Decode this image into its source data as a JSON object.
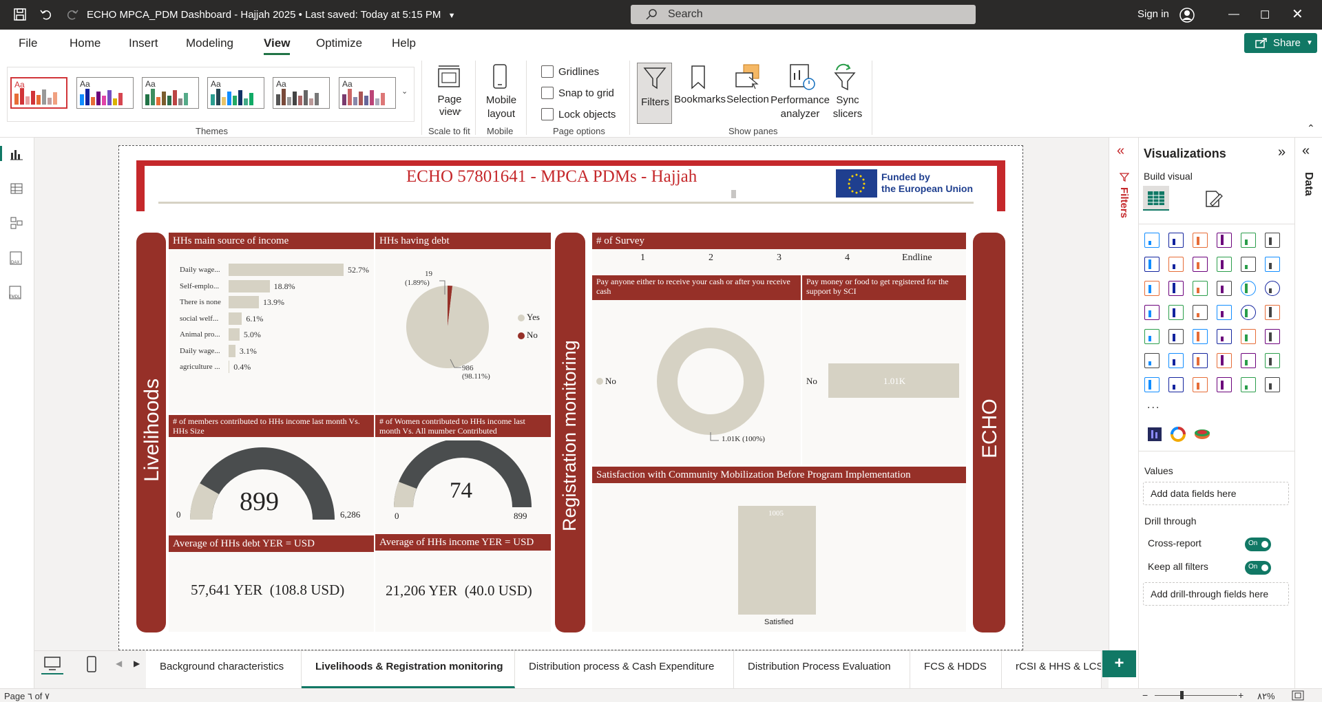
{
  "titlebar": {
    "file_title": "ECHO MPCA_PDM Dashboard - Hajjah 2025",
    "saved": "Last saved: Today at 5:15 PM",
    "search_placeholder": "Search",
    "signin": "Sign in"
  },
  "menu": {
    "items": [
      "File",
      "Home",
      "Insert",
      "Modeling",
      "View",
      "Optimize",
      "Help"
    ],
    "active": "View",
    "share": "Share"
  },
  "ribbon": {
    "themes_label": "Themes",
    "page_view": "Page view",
    "scale_to_fit": "Scale to fit",
    "mobile_layout": "Mobile layout",
    "mobile": "Mobile",
    "gridlines": "Gridlines",
    "snap_to_grid": "Snap to grid",
    "lock_objects": "Lock objects",
    "page_options": "Page options",
    "filters": "Filters",
    "bookmarks": "Bookmarks",
    "selection": "Selection",
    "performance": "Performance analyzer",
    "sync": "Sync slicers",
    "show_panes": "Show panes"
  },
  "report": {
    "title": "ECHO 57801641 - MPCA PDMs - Hajjah",
    "eu_line1": "Funded by",
    "eu_line2": "the European Union",
    "band_left": "Livelihoods",
    "band_middle": "Registration monitoring",
    "band_right": "ECHO",
    "income": {
      "title": "HHs main source of income",
      "rows": [
        {
          "label": "Daily wage...",
          "value": 52.7,
          "text": "52.7%"
        },
        {
          "label": "Self-emplo...",
          "value": 18.8,
          "text": "18.8%"
        },
        {
          "label": "There is none",
          "value": 13.9,
          "text": "13.9%"
        },
        {
          "label": "social welf...",
          "value": 6.1,
          "text": "6.1%"
        },
        {
          "label": "Animal pro...",
          "value": 5.0,
          "text": "5.0%"
        },
        {
          "label": "Daily wage...",
          "value": 3.1,
          "text": "3.1%"
        },
        {
          "label": "agriculture ...",
          "value": 0.4,
          "text": "0.4%"
        }
      ]
    },
    "debt": {
      "title": "HHs having debt",
      "no_label": "19",
      "no_pct": "(1.89%)",
      "yes_label": "986",
      "yes_pct": "(98.11%)",
      "legend_yes": "Yes",
      "legend_no": "No"
    },
    "members_gauge": {
      "title": "# of members contributed to HHs income last month Vs. HHs Size",
      "value": "899",
      "min": "0",
      "max": "6,286"
    },
    "women_gauge": {
      "title": "# of Women contributed to HHs income last month Vs. All mumber Contributed",
      "value": "74",
      "min": "0",
      "max": "899"
    },
    "avg_debt": {
      "title": "Average of HHs debt YER = USD",
      "yer": "57,641 YER",
      "usd": "(108.8 USD)"
    },
    "avg_income": {
      "title": "Average of HHs income YER = USD",
      "yer": "21,206 YER",
      "usd": "(40.0 USD)"
    },
    "survey": {
      "title": "# of Survey",
      "items": [
        "1",
        "2",
        "3",
        "4",
        "Endline"
      ]
    },
    "pay_anyone": {
      "title": "Pay anyone either to receive your cash or after you receive cash",
      "legend": "No",
      "label": "1.01K (100%)"
    },
    "pay_money": {
      "title": "Pay money or food to get registered for the support by SCI",
      "category": "No",
      "label": "1.01K"
    },
    "satisfaction": {
      "title": "Satisfaction with Community Mobilization Before Program Implementation",
      "value_label": "1005",
      "category": "Satisfied"
    }
  },
  "viz_pane": {
    "title": "Visualizations",
    "build_visual": "Build visual",
    "values": "Values",
    "add_data": "Add data fields here",
    "drill_through": "Drill through",
    "cross_report": "Cross-report",
    "keep_filters": "Keep all filters",
    "on": "On",
    "add_drill": "Add drill-through fields here",
    "more": "..."
  },
  "filters_pane": {
    "label": "Filters"
  },
  "data_pane": {
    "label": "Data"
  },
  "tabs": [
    "Background characteristics",
    "Livelihoods & Registration monitoring",
    "Distribution process & Cash Expenditure",
    "Distribution Process Evaluation",
    "FCS & HDDS",
    "rCSI & HHS & LCS"
  ],
  "active_tab": "Livelihoods & Registration monitoring",
  "status": {
    "page": "Page ٦ of ٧",
    "zoom": "٨٢%"
  },
  "colors": {
    "maroon": "#963028",
    "red": "#c5282b",
    "beige": "#d6d2c4",
    "gauge_dark": "#4a4d4e",
    "teal": "#117865"
  },
  "chart_data": [
    {
      "type": "bar",
      "title": "HHs main source of income",
      "categories": [
        "Daily wage...",
        "Self-emplo...",
        "There is none",
        "social welf...",
        "Animal pro...",
        "Daily wage...",
        "agriculture ..."
      ],
      "values": [
        52.7,
        18.8,
        13.9,
        6.1,
        5.0,
        3.1,
        0.4
      ]
    },
    {
      "type": "pie",
      "title": "HHs having debt",
      "categories": [
        "Yes",
        "No"
      ],
      "values": [
        986,
        19
      ]
    },
    {
      "type": "pie",
      "title": "Pay anyone either to receive your cash or after you receive cash",
      "categories": [
        "No"
      ],
      "values": [
        1010
      ]
    },
    {
      "type": "bar",
      "title": "Pay money or food to get registered for the support by SCI",
      "categories": [
        "No"
      ],
      "values": [
        1010
      ]
    },
    {
      "type": "bar",
      "title": "Satisfaction with Community Mobilization Before Program Implementation",
      "categories": [
        "Satisfied"
      ],
      "values": [
        1005
      ]
    }
  ]
}
